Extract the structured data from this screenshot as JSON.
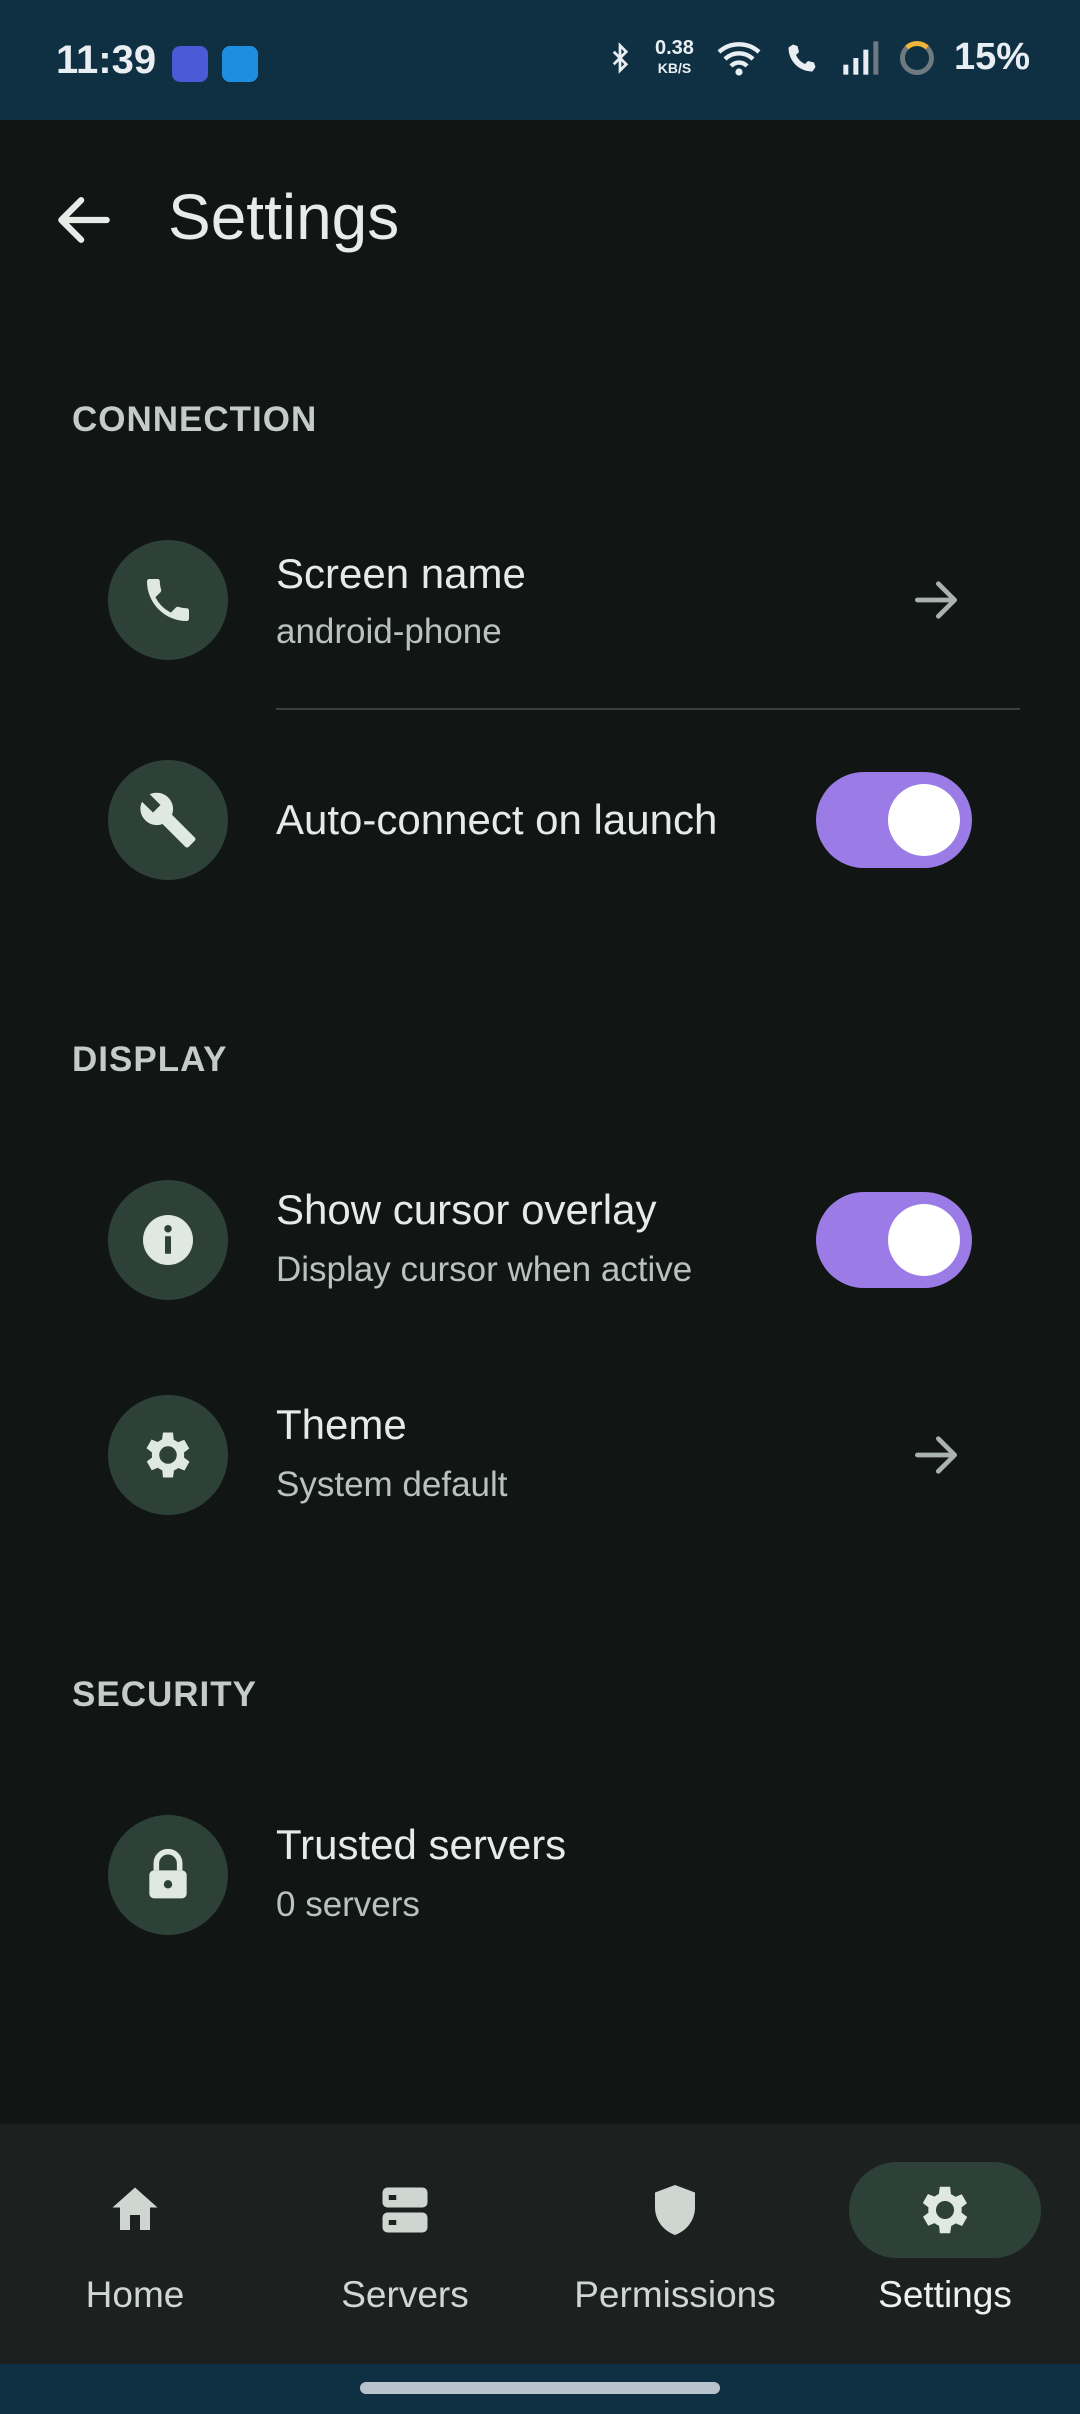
{
  "status_bar": {
    "time": "11:39",
    "speed_value": "0.38",
    "speed_unit": "KB/S",
    "battery": "15%"
  },
  "header": {
    "title": "Settings"
  },
  "sections": {
    "connection": {
      "header": "CONNECTION",
      "screen_name": {
        "title": "Screen name",
        "subtitle": "android-phone",
        "icon": "phone-icon"
      },
      "auto_connect": {
        "title": "Auto-connect on launch",
        "icon": "wrench-icon",
        "enabled": true
      }
    },
    "display": {
      "header": "DISPLAY",
      "cursor_overlay": {
        "title": "Show cursor overlay",
        "subtitle": "Display cursor when active",
        "icon": "info-icon",
        "enabled": true
      },
      "theme": {
        "title": "Theme",
        "subtitle": "System default",
        "icon": "gear-icon"
      }
    },
    "security": {
      "header": "SECURITY",
      "trusted_servers": {
        "title": "Trusted servers",
        "subtitle": "0 servers",
        "icon": "lock-icon"
      }
    }
  },
  "nav": {
    "items": [
      {
        "label": "Home",
        "icon": "home-icon"
      },
      {
        "label": "Servers",
        "icon": "servers-icon"
      },
      {
        "label": "Permissions",
        "icon": "shield-icon"
      },
      {
        "label": "Settings",
        "icon": "gear-icon",
        "active": true
      }
    ]
  },
  "colors": {
    "accent_toggle": "#9b7ce6",
    "icon_circle": "#2d4138",
    "status_bar": "#0f2f42",
    "background": "#111614"
  }
}
